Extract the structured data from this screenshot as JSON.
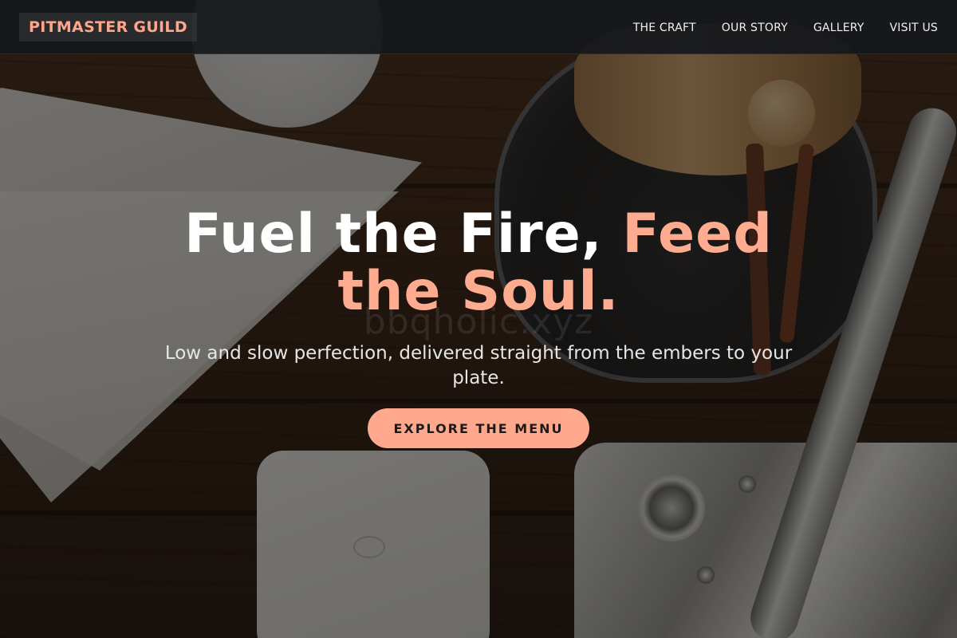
{
  "brand": {
    "name": "PITMASTER GUILD"
  },
  "nav": {
    "items": [
      {
        "label": "THE CRAFT"
      },
      {
        "label": "OUR STORY"
      },
      {
        "label": "GALLERY"
      },
      {
        "label": "VISIT US"
      }
    ]
  },
  "hero": {
    "headline_main": "Fuel the Fire, ",
    "headline_accent": "Feed the Soul.",
    "subtitle": "Low and slow perfection, delivered straight from the embers to your plate.",
    "cta_label": "EXPLORE THE MENU",
    "watermark": "bbqholic.xyz"
  },
  "colors": {
    "accent": "#ffa88d",
    "navbar_bg": "#16181c",
    "headline": "#ffffff"
  }
}
